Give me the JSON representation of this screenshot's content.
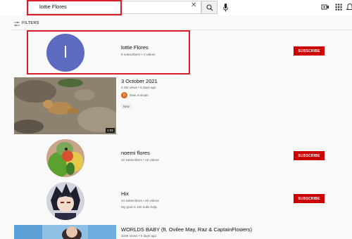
{
  "header": {
    "search_value": "lottie Flores",
    "icons": [
      "clear-icon",
      "search-icon",
      "mic-icon",
      "create-icon",
      "apps-icon",
      "notifications-icon"
    ]
  },
  "filters": {
    "label": "FILTERS",
    "icon": "filters-icon"
  },
  "results": [
    {
      "type": "channel",
      "name": "lottie Flores",
      "meta": "5 subscribers • 4 videos",
      "avatar_letter": "l",
      "avatar_color": "#5c6bc0",
      "subscribe_label": "SUBSCRIBE"
    },
    {
      "type": "video",
      "title": "3 October 2021",
      "meta": "2.2M views • 5 days ago",
      "channel": "Dasi Animals",
      "channel_initial": "D",
      "badge": "New",
      "duration": "1:02"
    },
    {
      "type": "channel",
      "name": "noemi flores",
      "meta": "10 subscribers • 16 videos",
      "subscribe_label": "SUBSCRIBE"
    },
    {
      "type": "channel",
      "name": "Hix",
      "meta": "24 subscribers • 26 videos",
      "description": "My goal is 100 subs help.",
      "subscribe_label": "SUBSCRIBE"
    },
    {
      "type": "video",
      "title": "WORLDS BABY (ft. Ovilee May, Raz & CaptainFlowers)",
      "meta": "333K views • 6 days ago"
    }
  ],
  "colors": {
    "accent": "#cc0000",
    "highlight": "#d61f2a"
  }
}
